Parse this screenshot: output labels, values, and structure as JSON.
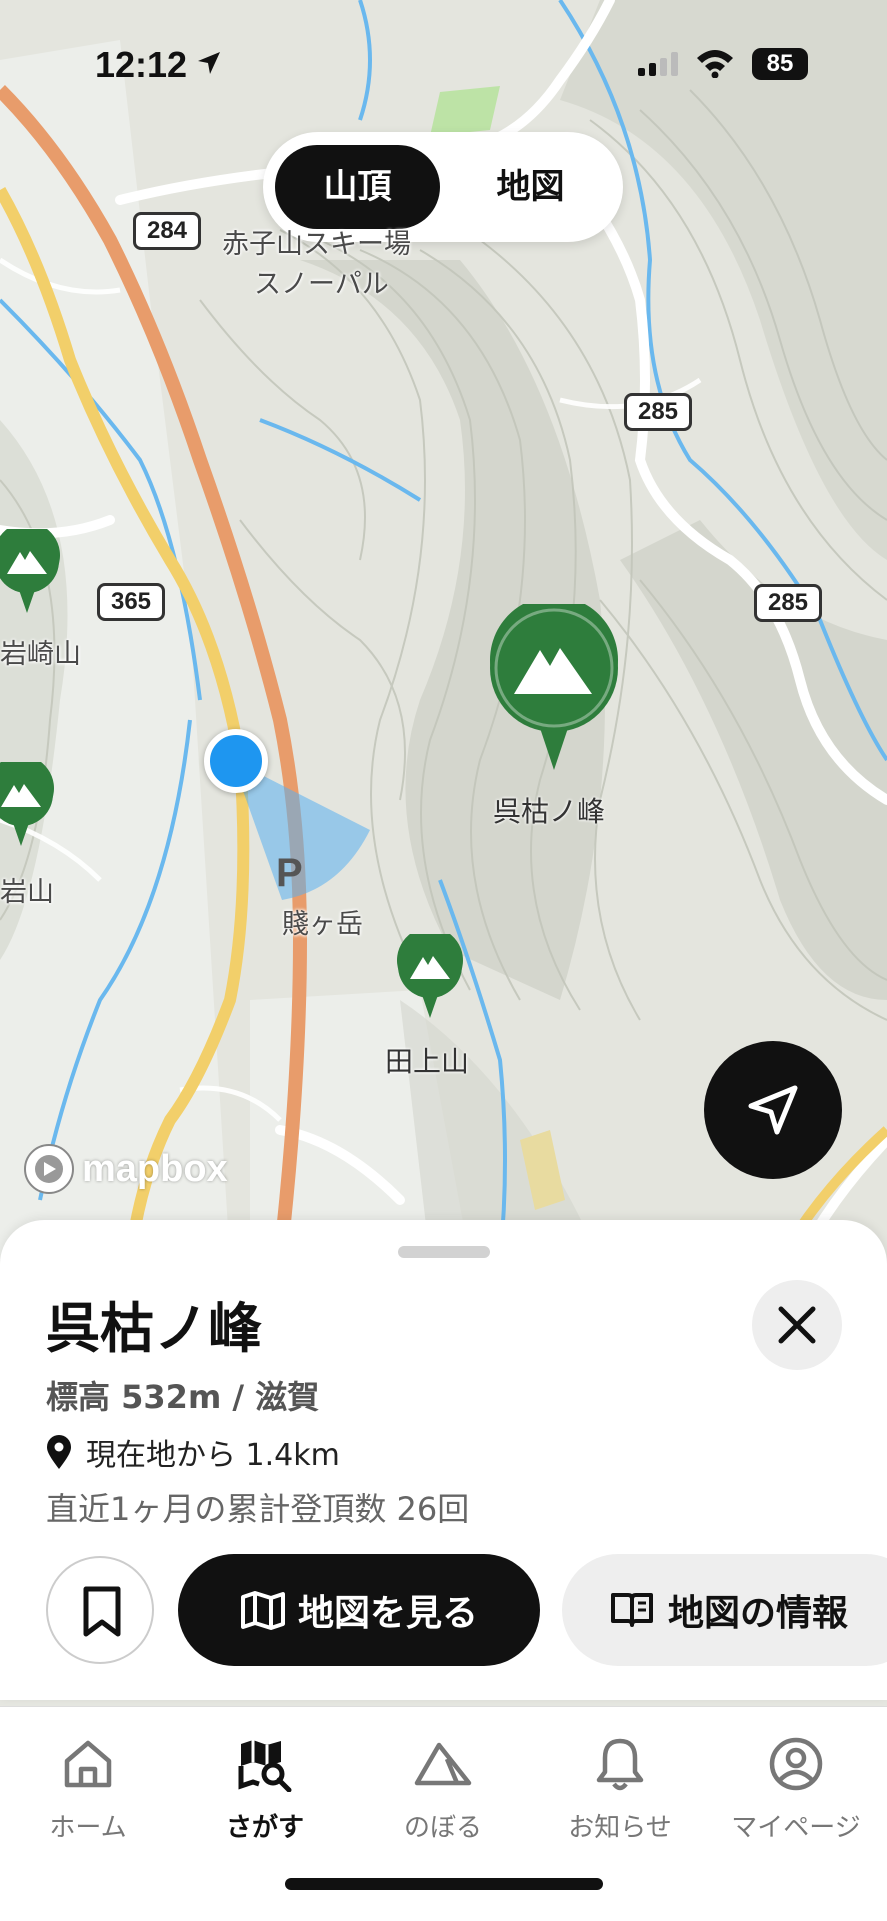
{
  "status": {
    "time": "12:12",
    "battery": "85"
  },
  "segment": {
    "active": "山頂",
    "inactive": "地図"
  },
  "map": {
    "shields": [
      "284",
      "285",
      "365",
      "285"
    ],
    "labels": [
      "赤子山スキー場",
      "スノーパル",
      "岩崎山",
      "岩山",
      "賤ヶ岳",
      "P"
    ],
    "peaks": [
      {
        "name": "呉枯ノ峰",
        "selected": true
      },
      {
        "name": "田上山",
        "selected": false
      },
      {
        "name": "",
        "selected": false
      },
      {
        "name": "",
        "selected": false
      }
    ],
    "attribution": "mapbox"
  },
  "sheet": {
    "title": "呉枯ノ峰",
    "elevation": "標高 532m / 滋賀",
    "distance": "現在地から 1.4km",
    "summit_count": "直近1ヶ月の累計登頂数 26回",
    "view_map_label": "地図を見る",
    "map_info_label": "地図の情報"
  },
  "tabs": [
    {
      "label": "ホーム",
      "icon": "home-icon",
      "active": false
    },
    {
      "label": "さがす",
      "icon": "search-map-icon",
      "active": true
    },
    {
      "label": "のぼる",
      "icon": "mountain-icon",
      "active": false
    },
    {
      "label": "お知らせ",
      "icon": "bell-icon",
      "active": false
    },
    {
      "label": "マイページ",
      "icon": "user-icon",
      "active": false
    }
  ],
  "colors": {
    "pin_green": "#2e7d3c",
    "location_blue": "#1e96f0",
    "accent": "#111111"
  }
}
